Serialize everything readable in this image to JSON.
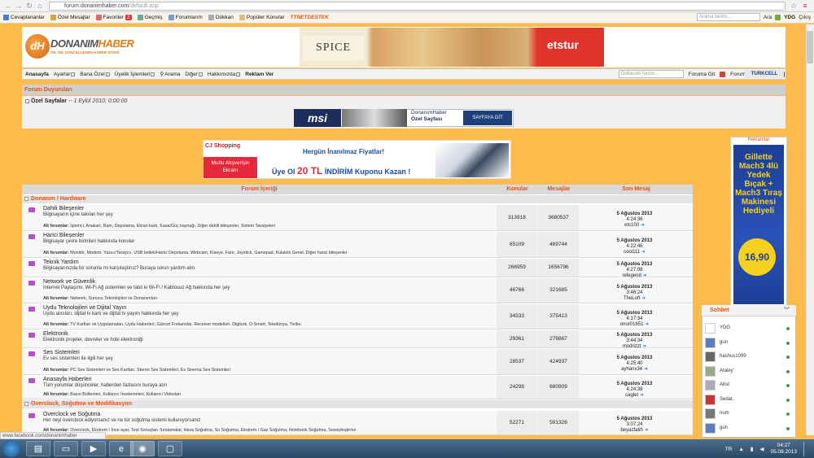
{
  "browser": {
    "url_host": "forum.donanimhaber.com",
    "url_path": "/default.asp"
  },
  "bookmarks": {
    "items": [
      "Cevaplananlar",
      "Özel Mesajlar",
      "Favoriler",
      "Geçmiş",
      "Forumlarım",
      "Dükkan",
      "Popüler Konular"
    ],
    "fav_badge": "2",
    "ttnet": "TTNETDESTEK",
    "search_placeholder": "Arama terimi....",
    "search_btn": "Ara",
    "user": "YDG",
    "logout": "Çıkış"
  },
  "header": {
    "logo_main_a": "DONANIM",
    "logo_main_b": "HABER",
    "logo_sub": "SIK SIK GÜNCELLENEN HABER SİTESİ",
    "banner_left": "SPICE",
    "banner_right": "etstur"
  },
  "nav": {
    "items": [
      "Anasayfa",
      "Ayarlar",
      "Bana Özel",
      "Üyelik İşlemleri",
      "Arama",
      "Diğer",
      "Hakkımızda",
      "Reklam Ver"
    ],
    "search_placeholder": "Gidilecek forum...",
    "go": "Foruma Git",
    "destek": "Forum Destek",
    "turkcell": "TURKCELL"
  },
  "announcements": {
    "title": "Forum Duyuruları",
    "item_title": "Özel Sayfalar",
    "item_date": "-- 1 Eylül 2010; 0:00:00",
    "msi_logo": "msi",
    "msi_text1": "DonanımHaber",
    "msi_text2": "Özel Sayfası",
    "msi_btn": "SAYFAYA GİT"
  },
  "promo": {
    "cj": "CJ Shopping",
    "mutlu": "Mutlu Alışverişin Ekranı",
    "line1": "Hergün İnanılmaz Fiyatlar!",
    "line2_a": "Üye Ol",
    "line2_b": "20 TL",
    "line2_c": "İNDİRİM Kuponu Kazan !"
  },
  "table": {
    "headers": [
      "Forum İçeriği",
      "Konular",
      "Mesajlar",
      "Son Mesaj"
    ],
    "alt_label": "Alt forumlar:",
    "categories": [
      "Donanım / Hardware",
      "Overclock, Soğutma ve Modifikasyon"
    ],
    "rows": [
      {
        "name": "Dahili Bileşenler",
        "desc": "Bilgisayarın içine takılan her şey",
        "sub": "İşlemci, Anakart, Ram, Depolama, Ekran kartı, Kasa/Güç kaynağı, Diğer dahili bileşenler, Sistem Tavsiyeleri",
        "topics": "313918",
        "posts": "3680537",
        "date": "5 Ağustos 2013",
        "time": "4:24:36",
        "user": "ets100"
      },
      {
        "name": "Harici Bileşenler",
        "desc": "Bilgisayar çevre birimleri hakkında konular",
        "sub": "Monitör, Modem, Yazıcı/Tarayıcı, USB bellek/Harici Depolama, Webcam, Klavye, Fare, Joystick, Gamepad, Kulaklık Genel, Diğer harici bileşenler",
        "topics": "65109",
        "posts": "469744",
        "date": "5 Ağustos 2013",
        "time": "4:22:46",
        "user": "cool111"
      },
      {
        "name": "Teknik Yardım",
        "desc": "Bilgisayarınızda bir sorunla mı karşılaştınız? Buraya sorun yardım alın.",
        "sub": "",
        "topics": "266959",
        "posts": "1656796",
        "date": "5 Ağustos 2013",
        "time": "4:27:08",
        "user": "relegend"
      },
      {
        "name": "Network ve Güvenlik",
        "desc": "İnternet Paylaşımı, Wi-Fi Ağ sistemleri ve tabii ki Wi-Fi / Kablosuz Ağ hakkında her şey",
        "sub": "Network, Sunucu Teknolojileri ve Donanımları",
        "topics": "46766",
        "posts": "321685",
        "date": "5 Ağustos 2013",
        "time": "3:46:24",
        "user": "TheLoft"
      },
      {
        "name": "Uydu Teknolojileri ve Dijital Yayın",
        "desc": "Uydu alıcıları, dijital tv kartı ve dijital tv yayını hakkında her şey",
        "sub": "TV Kartları ve Uygulamaları, Uydu Haberleri, Güncel Frekanslar, Receiver modelleri, Digiturk, D-Smart, Teledünya, Tivibu",
        "topics": "34333",
        "posts": "375413",
        "date": "5 Ağustos 2013",
        "time": "4:17:34",
        "user": "onur01651"
      },
      {
        "name": "Elektronik",
        "desc": "Elektronik projeler, devreler ve hobi elektroniği",
        "sub": "",
        "topics": "29361",
        "posts": "276867",
        "date": "5 Ağustos 2013",
        "time": "3:44:34",
        "user": "modrizzt"
      },
      {
        "name": "Ses Sistemleri",
        "desc": "Ev ses sistemleri ile ilgili her şey",
        "sub": "PC Ses Sistemleri ve Ses Kartları, Stereo Ses Sistemleri, Ev Sinema Ses Sistemleri",
        "topics": "28537",
        "posts": "424937",
        "date": "5 Ağustos 2013",
        "time": "4:25:40",
        "user": "ayhanx34"
      },
      {
        "name": "Anasayfa Haberleri",
        "desc": "Tüm yorumlar düşünceler, haberden fazlasını buraya atın",
        "sub": "Basın Bültenleri, Kullanıcı İncelemeleri, Kullanıcı Videoları",
        "topics": "24298",
        "posts": "680909",
        "date": "5 Ağustos 2013",
        "time": "4:24:38",
        "user": "caglet"
      },
      {
        "name": "Overclock ve Soğutma",
        "desc": "Her neyi overclock ediyorsanız ve ne tür soğutma sistemi kullanıyorsanız",
        "sub": "Overclock, Ekstrem / İnce ayar, Test Sonuçları Sıralamalar, Hava Soğutma, Su Soğutma, Ekstrem / Gaz Soğutma, Notebook Soğutma, Sessizleştirme",
        "topics": "52271",
        "posts": "591328",
        "date": "5 Ağustos 2013",
        "time": "3:07:24",
        "user": "beyazfatih"
      }
    ]
  },
  "ads": {
    "label": "Reklamlar",
    "gillette": "Gillette Mach3 4lü Yedek Bıçak + Mach3 Tıraş Makinesi Hediyeli",
    "price": "16,90"
  },
  "chat": {
    "title": "Sohbet",
    "users": [
      "YDG",
      "gun",
      "hashus1099",
      "Ataley'",
      "Abst",
      "Sedat.",
      "num",
      "gun"
    ]
  },
  "status": {
    "url": "www.facebook.com/donanimhaber"
  },
  "taskbar": {
    "lang": "TR",
    "time": "04:27",
    "date": "05.08.2013"
  }
}
